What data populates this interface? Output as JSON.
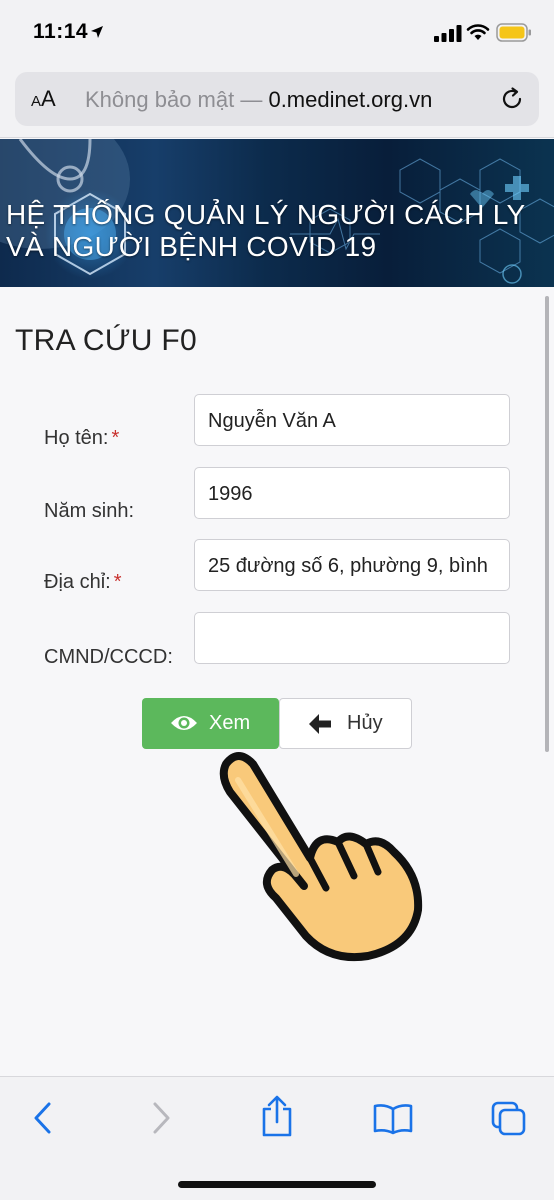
{
  "status_bar": {
    "time": "11:14"
  },
  "browser": {
    "text_size_label": "AA",
    "url_prefix": "Không bảo mật — ",
    "url_domain": "0.medinet.org.vn"
  },
  "banner": {
    "title_line1": "HỆ THỐNG QUẢN LÝ NGƯỜI CÁCH LY",
    "title_line2": "VÀ NGƯỜI BỆNH COVID 19"
  },
  "form": {
    "title": "TRA CỨU F0",
    "fields": [
      {
        "label": "Họ tên:",
        "required": "*",
        "value": "Nguyễn Văn A"
      },
      {
        "label": "Năm sinh:",
        "required": "",
        "value": "1996"
      },
      {
        "label": "Địa chỉ:",
        "required": "*",
        "value": "25 đường số 6, phường 9, bình"
      },
      {
        "label": "CMND/CCCD:",
        "required": "",
        "value": ""
      }
    ],
    "view_button": "Xem",
    "cancel_button": "Hủy"
  },
  "colors": {
    "primary_button": "#5cb85c",
    "required_mark": "#c8312e",
    "ios_blue": "#1a73e8"
  },
  "icons": {
    "status": [
      "location-arrow-icon",
      "signal-icon",
      "wifi-icon",
      "battery-icon"
    ],
    "toolbar": [
      "back-icon",
      "forward-icon",
      "share-icon",
      "bookmarks-icon",
      "tabs-icon"
    ]
  }
}
